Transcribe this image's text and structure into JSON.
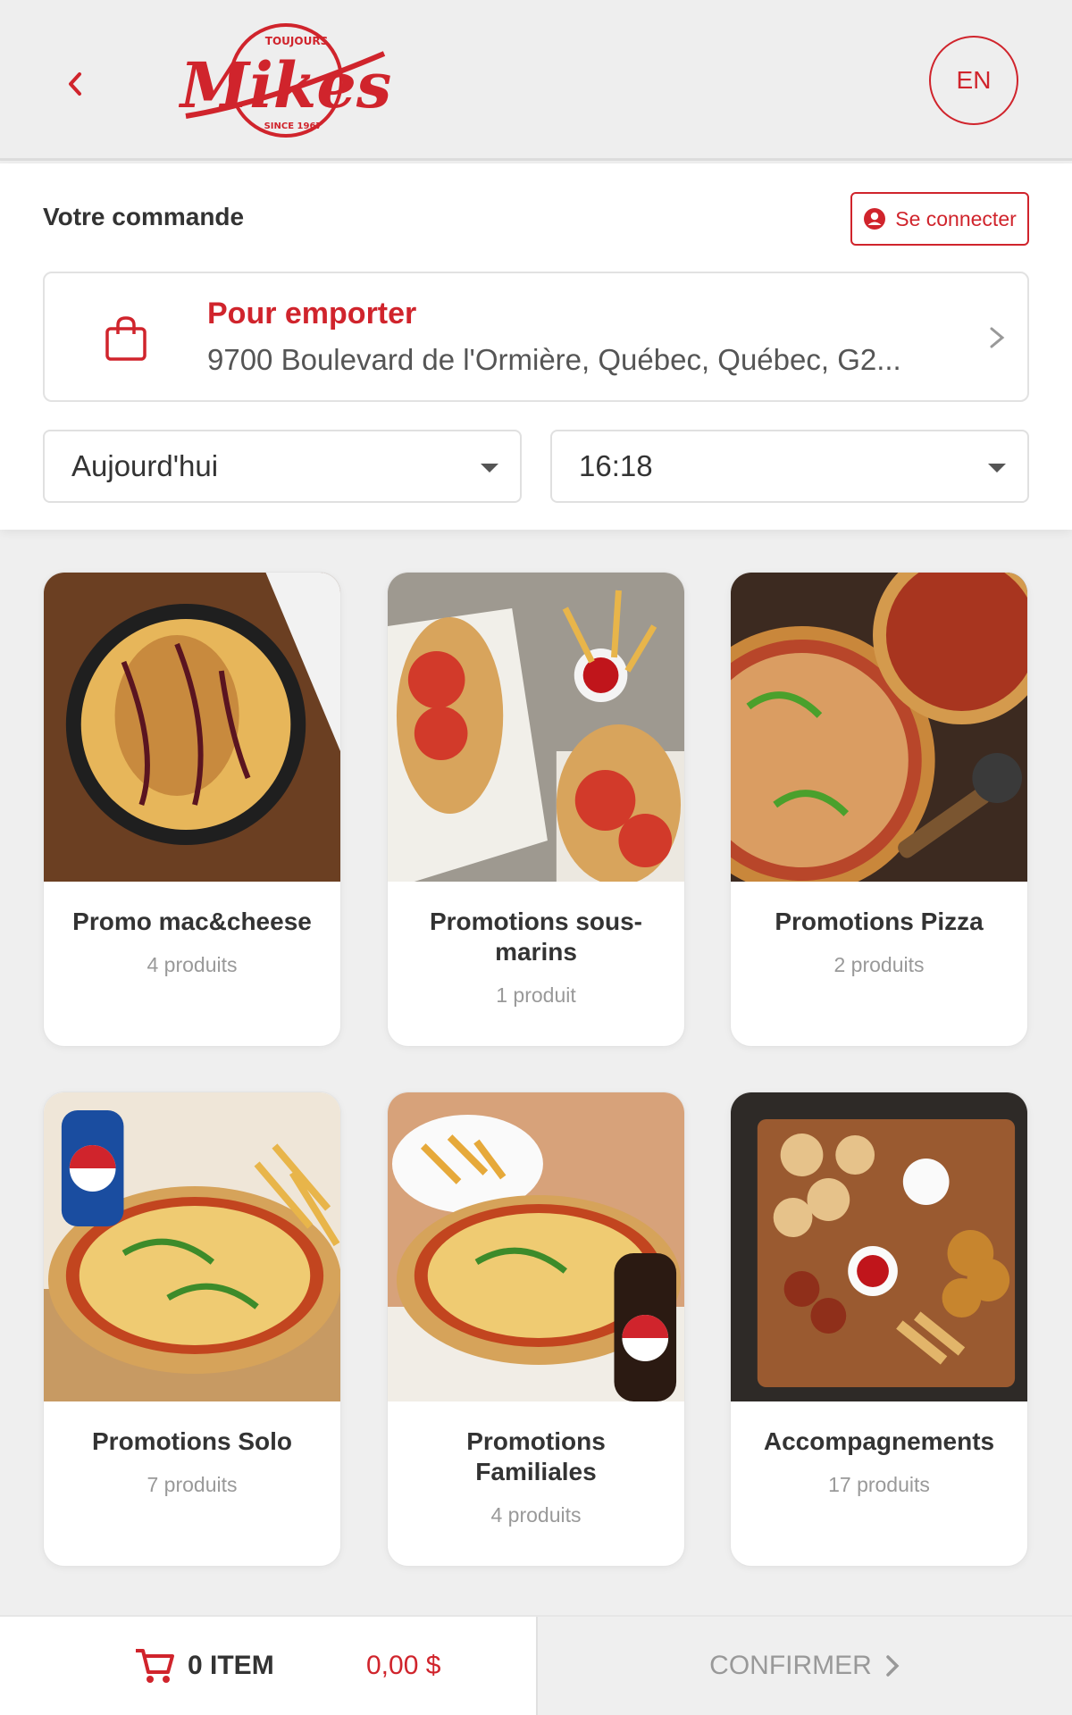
{
  "header": {
    "back_icon": "chevron-left-icon",
    "logo_text": "Mikes",
    "logo_top": "TOUJOURS",
    "logo_bottom": "SINCE 1967",
    "lang_label": "EN"
  },
  "order": {
    "title": "Votre commande",
    "login_label": "Se connecter",
    "mode": "Pour emporter",
    "address": "9700 Boulevard de l'Ormière, Québec, Québec, G2...",
    "day": "Aujourd'hui",
    "time": "16:18"
  },
  "categories": [
    {
      "title": "Promo mac&cheese",
      "count": "4 produits"
    },
    {
      "title": "Promotions sous-marins",
      "count": "1 produit"
    },
    {
      "title": "Promotions Pizza",
      "count": "2 produits"
    },
    {
      "title": "Promotions Solo",
      "count": "7 produits"
    },
    {
      "title": "Promotions Familiales",
      "count": "4 produits"
    },
    {
      "title": "Accompagnements",
      "count": "17 produits"
    }
  ],
  "cart": {
    "items_label": "0 ITEM",
    "total": "0,00 $",
    "confirm_label": "CONFIRMER"
  },
  "colors": {
    "brand": "#d0242c",
    "background": "#efefef"
  }
}
